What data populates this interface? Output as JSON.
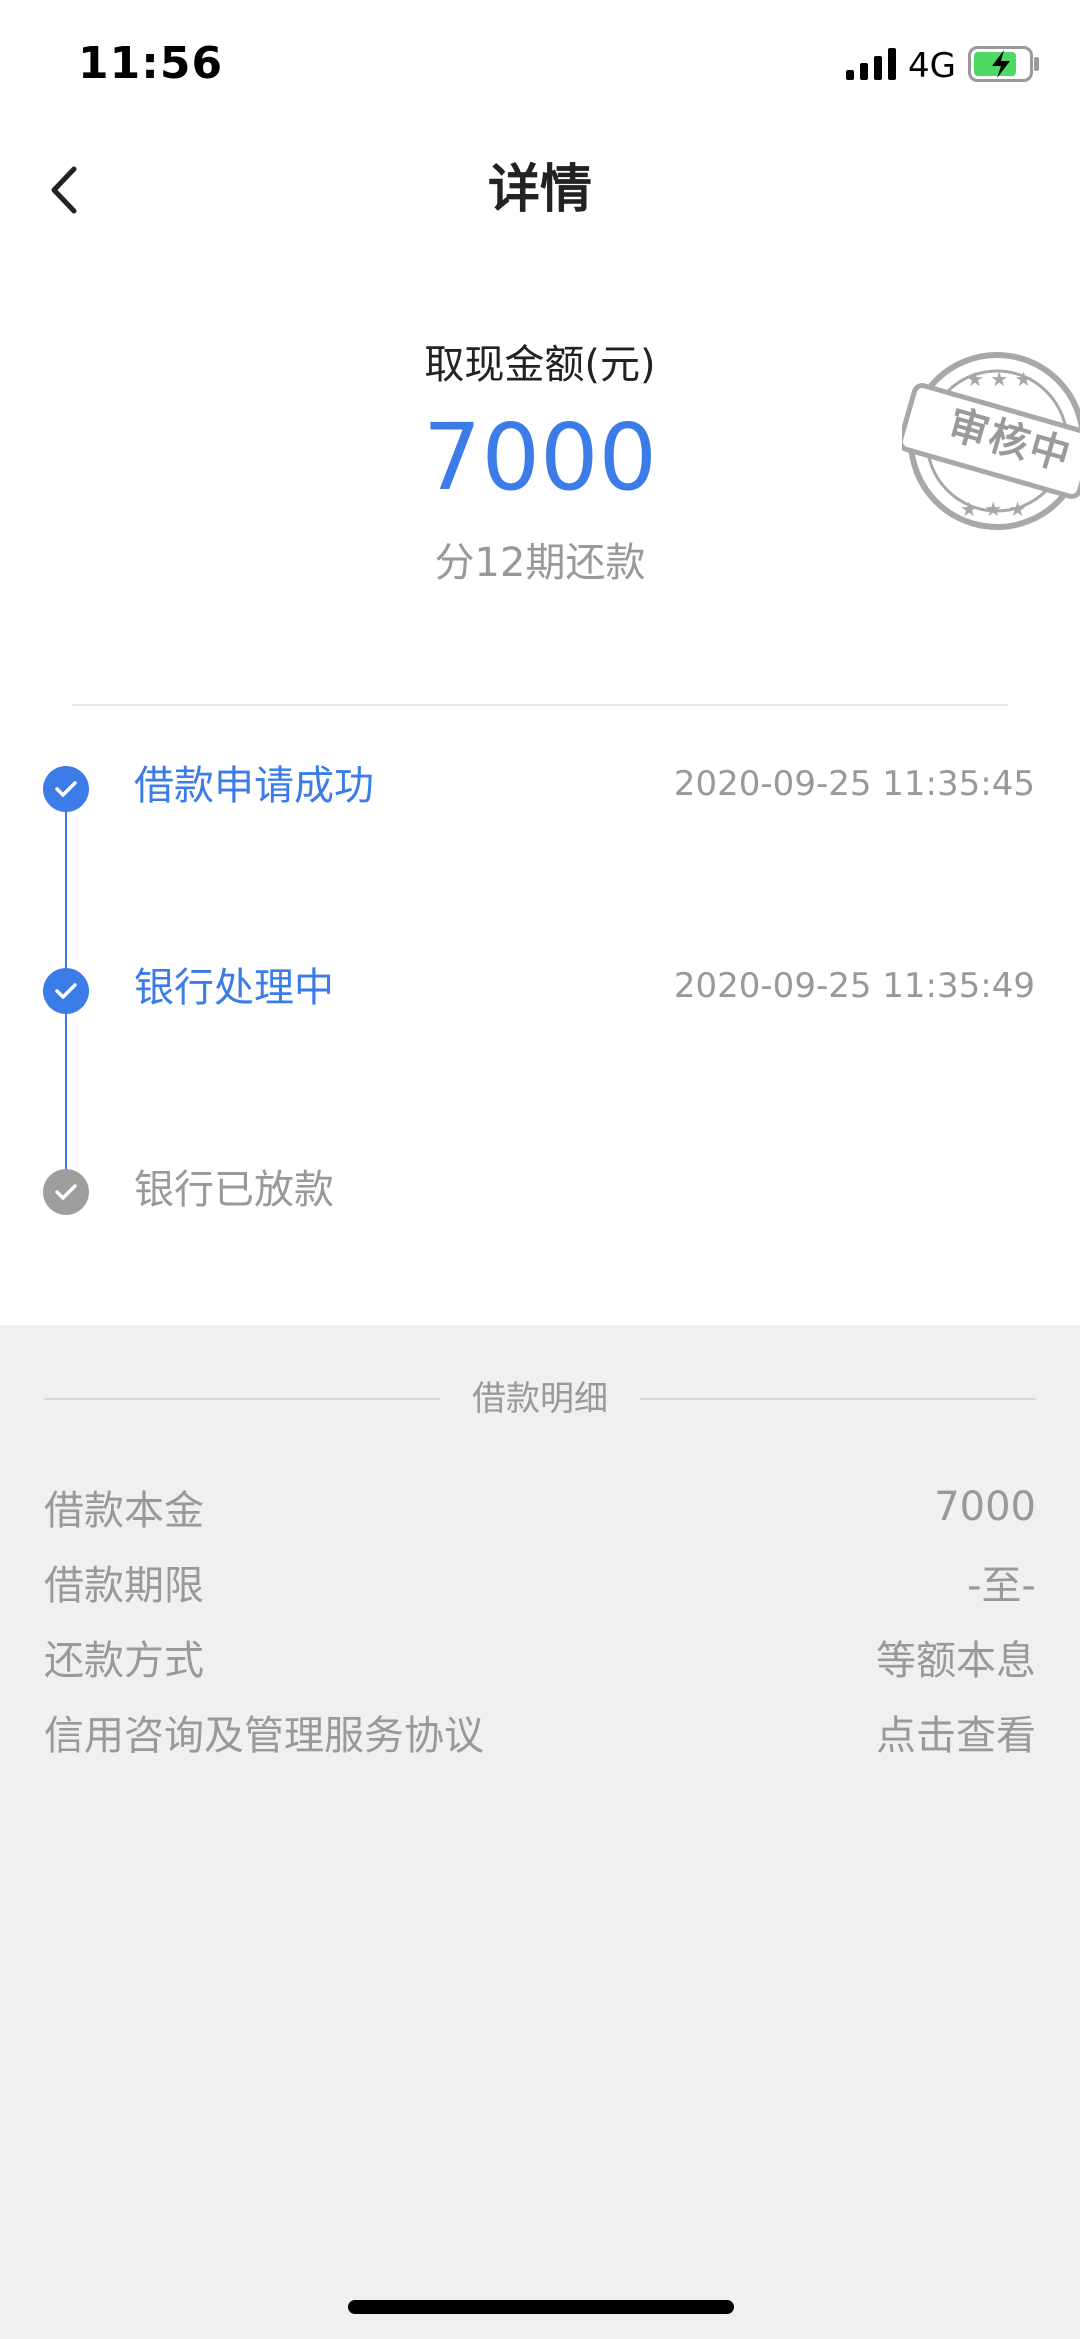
{
  "status_bar": {
    "time": "11:56",
    "network": "4G",
    "icons": [
      "signal-icon",
      "battery-icon"
    ]
  },
  "nav": {
    "title": "详情",
    "back_icon": "chevron-left-icon"
  },
  "summary": {
    "amount_label": "取现金额(元)",
    "amount_value": "7000",
    "installment_text": "分12期还款",
    "stamp_text": "审核中"
  },
  "timeline": {
    "steps": [
      {
        "label": "借款申请成功",
        "time": "2020-09-25 11:35:45",
        "status": "done"
      },
      {
        "label": "银行处理中",
        "time": "2020-09-25 11:35:49",
        "status": "done"
      },
      {
        "label": "银行已放款",
        "time": "",
        "status": "pending"
      }
    ]
  },
  "details": {
    "section_title": "借款明细",
    "rows": [
      {
        "label": "借款本金",
        "value": "7000"
      },
      {
        "label": "借款期限",
        "value": "-至-"
      },
      {
        "label": "还款方式",
        "value": "等额本息"
      },
      {
        "label": "信用咨询及管理服务协议",
        "value": "点击查看"
      }
    ]
  },
  "colors": {
    "accent": "#3b7ce8",
    "muted": "#999999",
    "pending": "#9e9e9e",
    "background": "#f0f0f0"
  }
}
